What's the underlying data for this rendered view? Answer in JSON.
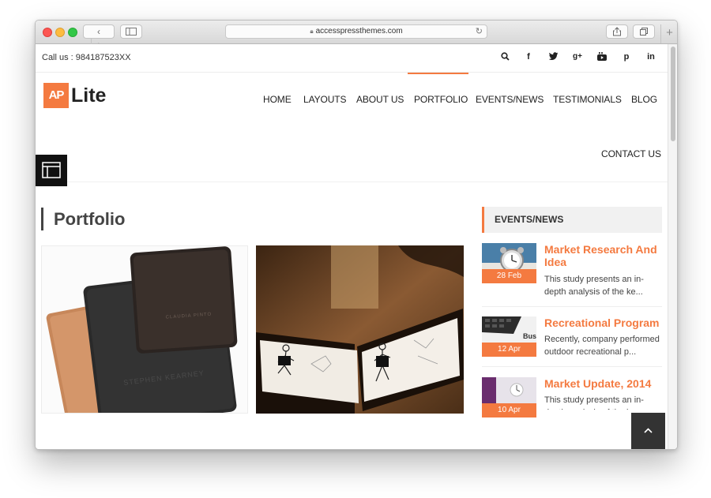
{
  "browser": {
    "url": "accesspressthemes.com",
    "nav_back": "‹",
    "nav_forward": "›",
    "new_tab": "+"
  },
  "topbar": {
    "call_text": "Call us : 984187523XX",
    "social": [
      {
        "name": "search",
        "glyph": ""
      },
      {
        "name": "facebook",
        "glyph": "f"
      },
      {
        "name": "twitter",
        "glyph": ""
      },
      {
        "name": "google-plus",
        "glyph": "g+"
      },
      {
        "name": "youtube",
        "glyph": ""
      },
      {
        "name": "pinterest",
        "glyph": "p"
      },
      {
        "name": "linkedin",
        "glyph": "in"
      }
    ]
  },
  "logo": {
    "mark": "AP",
    "text": "Lite"
  },
  "nav": {
    "items": [
      "HOME",
      "LAYOUTS",
      "ABOUT US",
      "PORTFOLIO",
      "EVENTS/NEWS",
      "TESTIMONIALS",
      "BLOG",
      "CONTACT US"
    ],
    "active": "PORTFOLIO"
  },
  "main": {
    "title": "Portfolio"
  },
  "events": {
    "heading": "EVENTS/NEWS",
    "items": [
      {
        "title": "Market Research And Idea",
        "date": "28 Feb",
        "desc": "This study presents an in-depth analysis of the ke..."
      },
      {
        "title": "Recreational Program",
        "date": "12 Apr",
        "desc": "Recently, company performed outdoor recreational p..."
      },
      {
        "title": "Market Update, 2014",
        "date": "10 Apr",
        "desc": "This study presents an in-depth analysis of the ke..."
      }
    ]
  },
  "colors": {
    "accent": "#f47a40",
    "dark": "#111111",
    "text": "#333333"
  }
}
